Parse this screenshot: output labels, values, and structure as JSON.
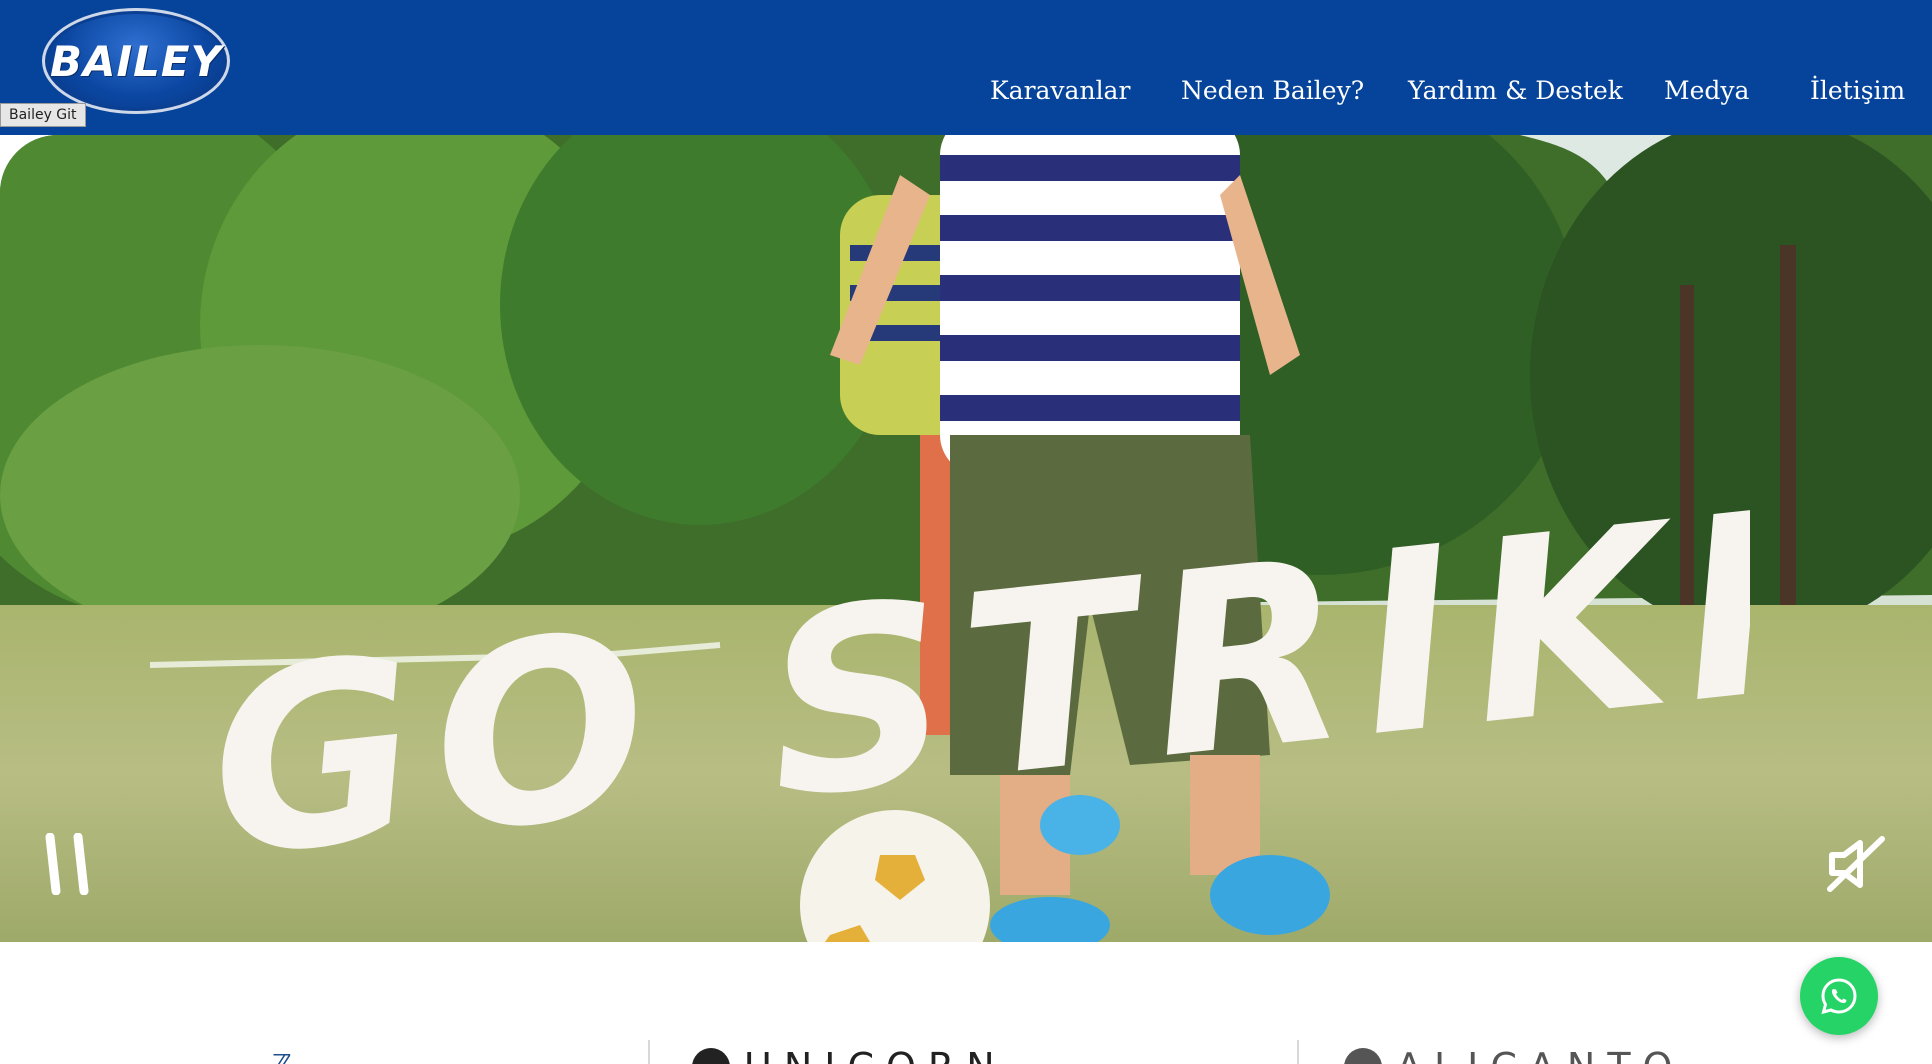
{
  "header": {
    "logo_text": "BAILEY",
    "logo_tooltip": "Bailey Git",
    "background_color": "#05449a",
    "nav": [
      {
        "label": "Karavanlar"
      },
      {
        "label": "Neden Bailey?"
      },
      {
        "label": "Yardım & Destek"
      },
      {
        "label": "Medya"
      },
      {
        "label": "İletişim"
      }
    ]
  },
  "hero": {
    "headline": "GO STRIKING",
    "controls": {
      "pause_icon": "pause-icon",
      "mute_icon": "speaker-muted-icon"
    }
  },
  "brands": [
    {
      "name": "",
      "icon": "brand-logo-mark"
    },
    {
      "name": "UNICORN",
      "icon": "unicorn-logo-icon"
    },
    {
      "name": "ALICANTO",
      "icon": "alicanto-logo-icon"
    }
  ],
  "floating": {
    "whatsapp_icon": "whatsapp-icon",
    "whatsapp_color": "#25d366"
  }
}
